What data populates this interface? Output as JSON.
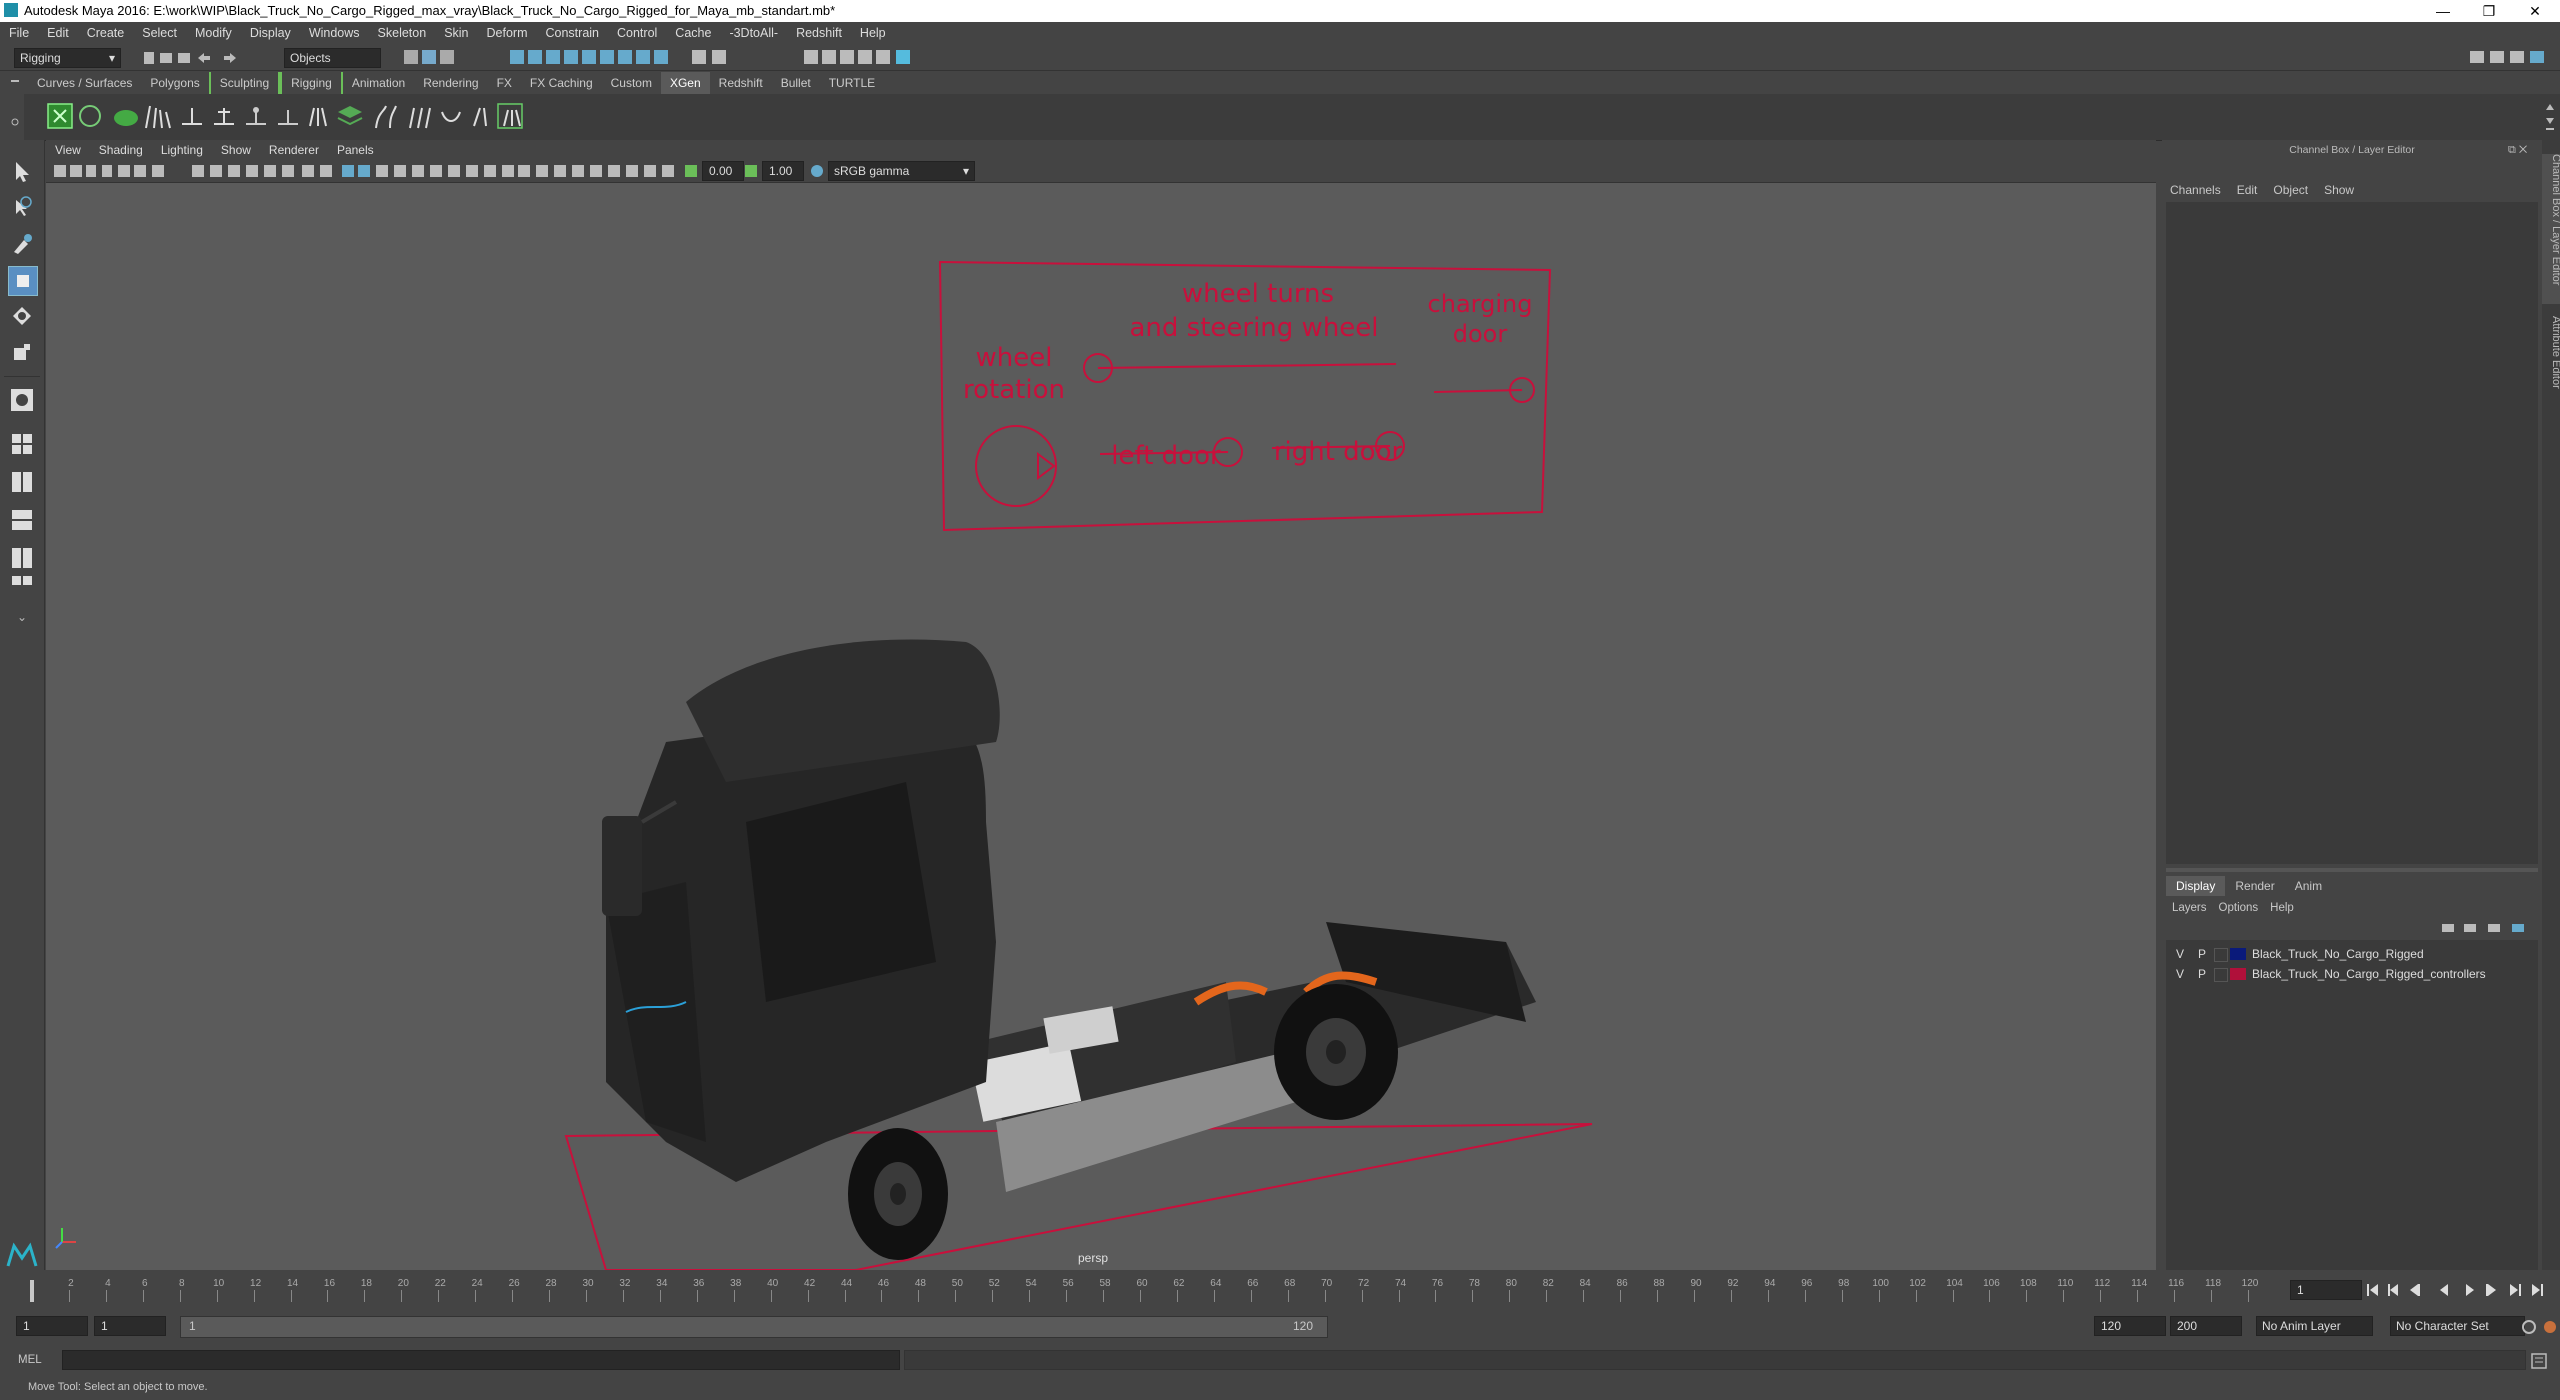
{
  "window": {
    "title": "Autodesk Maya 2016: E:\\work\\WIP\\Black_Truck_No_Cargo_Rigged_max_vray\\Black_Truck_No_Cargo_Rigged_for_Maya_mb_standart.mb*",
    "minimize": "—",
    "restore": "❐",
    "close": "✕"
  },
  "menubar": [
    "File",
    "Edit",
    "Create",
    "Select",
    "Modify",
    "Display",
    "Windows",
    "Skeleton",
    "Skin",
    "Deform",
    "Constrain",
    "Control",
    "Cache",
    "-3DtoAll-",
    "Redshift",
    "Help"
  ],
  "status_line": {
    "menuset": "Rigging",
    "selection_mode": "Objects"
  },
  "shelf_tabs": [
    "Curves / Surfaces",
    "Polygons",
    "Sculpting",
    "Rigging",
    "Animation",
    "Rendering",
    "FX",
    "FX Caching",
    "Custom",
    "XGen",
    "Redshift",
    "Bullet",
    "TURTLE"
  ],
  "shelf_active": "XGen",
  "viewport": {
    "menu": [
      "View",
      "Shading",
      "Lighting",
      "Show",
      "Renderer",
      "Panels"
    ],
    "exposure": "0.00",
    "gamma": "1.00",
    "color_space": "sRGB gamma",
    "camera_label": "persp"
  },
  "rig_panel": {
    "wheel_rotation": [
      "wheel",
      "rotation"
    ],
    "wheel_turns": [
      "wheel turns",
      "and steering wheel"
    ],
    "charging_door": [
      "charging",
      "door"
    ],
    "left_door": "left door",
    "right_door": "right door"
  },
  "channel_box": {
    "title": "Channel Box / Layer Editor",
    "menu": [
      "Channels",
      "Edit",
      "Object",
      "Show"
    ],
    "side_tabs": [
      "Channel Box / Layer Editor",
      "Attribute Editor"
    ]
  },
  "layer_editor": {
    "tabs": [
      "Display",
      "Render",
      "Anim"
    ],
    "active_tab": "Display",
    "menu": [
      "Layers",
      "Options",
      "Help"
    ],
    "layers": [
      {
        "v": "V",
        "p": "P",
        "color": "#0a1a7a",
        "name": "Black_Truck_No_Cargo_Rigged"
      },
      {
        "v": "V",
        "p": "P",
        "color": "#b0103a",
        "name": "Black_Truck_No_Cargo_Rigged_controllers"
      }
    ]
  },
  "timeline": {
    "ticks": [
      "2",
      "4",
      "6",
      "8",
      "10",
      "12",
      "14",
      "16",
      "18",
      "20",
      "22",
      "24",
      "26",
      "28",
      "30",
      "32",
      "34",
      "36",
      "38",
      "40",
      "42",
      "44",
      "46",
      "48",
      "50",
      "52",
      "54",
      "56",
      "58",
      "60",
      "62",
      "64",
      "66",
      "68",
      "70",
      "72",
      "74",
      "76",
      "78",
      "80",
      "82",
      "84",
      "86",
      "88",
      "90",
      "92",
      "94",
      "96",
      "98",
      "100",
      "102",
      "104",
      "106",
      "108",
      "110",
      "112",
      "114",
      "116",
      "118",
      "120"
    ],
    "current_frame": "1"
  },
  "range": {
    "start": "1",
    "playback_start": "1",
    "slider_start": "1",
    "slider_end": "120",
    "playback_end": "120",
    "end": "200",
    "anim_layer": "No Anim Layer",
    "character_set": "No Character Set"
  },
  "command_line": {
    "lang": "MEL"
  },
  "help_line": "Move Tool: Select an object to move."
}
